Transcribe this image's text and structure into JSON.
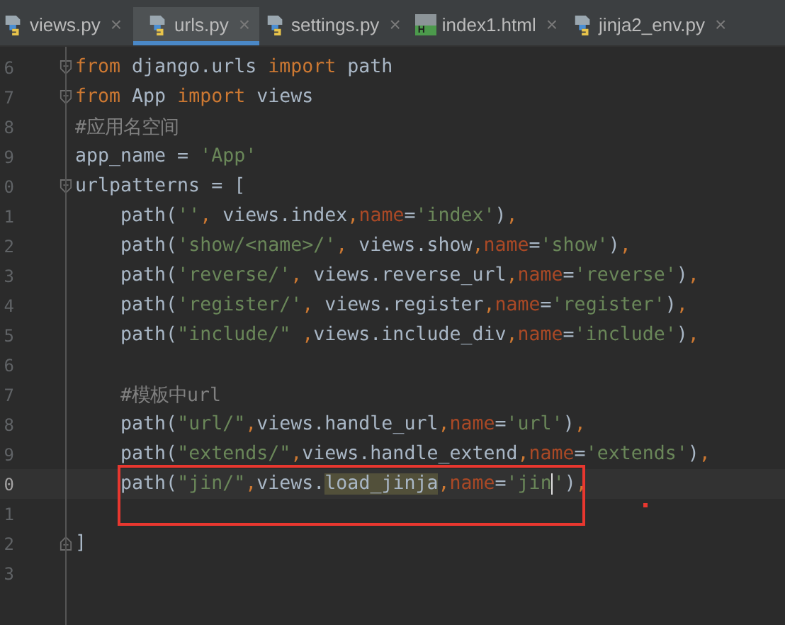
{
  "tabs": [
    {
      "label": "views.py",
      "kind": "python",
      "selected": false
    },
    {
      "label": "urls.py",
      "kind": "python",
      "selected": true
    },
    {
      "label": "settings.py",
      "kind": "python",
      "selected": false
    },
    {
      "label": "index1.html",
      "kind": "html",
      "badge": "H",
      "selected": false
    },
    {
      "label": "jinja2_env.py",
      "kind": "python",
      "selected": false
    }
  ],
  "close_glyph": "×",
  "lines": [
    {
      "number": "6",
      "fold_start": true,
      "current": false,
      "tokens": [
        {
          "kind": "keyword",
          "text": "from"
        },
        {
          "kind": "plain",
          "text": " django.urls "
        },
        {
          "kind": "keyword",
          "text": "import"
        },
        {
          "kind": "plain",
          "text": " path"
        }
      ]
    },
    {
      "number": "7",
      "fold_start": true,
      "current": false,
      "tokens": [
        {
          "kind": "keyword",
          "text": "from"
        },
        {
          "kind": "plain",
          "text": " App "
        },
        {
          "kind": "keyword",
          "text": "import"
        },
        {
          "kind": "plain",
          "text": " views"
        }
      ]
    },
    {
      "number": "8",
      "current": false,
      "tokens": [
        {
          "kind": "comment",
          "text": "#应用名空间"
        }
      ]
    },
    {
      "number": "9",
      "current": false,
      "tokens": [
        {
          "kind": "plain",
          "text": "app_name = "
        },
        {
          "kind": "string",
          "text": "'App'"
        }
      ]
    },
    {
      "number": "0",
      "fold_start": true,
      "current": false,
      "tokens": [
        {
          "kind": "plain",
          "text": "urlpatterns = ["
        }
      ]
    },
    {
      "number": "1",
      "current": false,
      "tokens": [
        {
          "kind": "plain",
          "text": "    path("
        },
        {
          "kind": "string",
          "text": "''"
        },
        {
          "kind": "keyword",
          "text": ","
        },
        {
          "kind": "plain",
          "text": " views.index"
        },
        {
          "kind": "keyword",
          "text": ","
        },
        {
          "kind": "param",
          "text": "name"
        },
        {
          "kind": "plain",
          "text": "="
        },
        {
          "kind": "string",
          "text": "'index'"
        },
        {
          "kind": "plain",
          "text": ")"
        },
        {
          "kind": "keyword",
          "text": ","
        }
      ]
    },
    {
      "number": "2",
      "current": false,
      "tokens": [
        {
          "kind": "plain",
          "text": "    path("
        },
        {
          "kind": "string",
          "text": "'show/<name>/'"
        },
        {
          "kind": "keyword",
          "text": ","
        },
        {
          "kind": "plain",
          "text": " views.show"
        },
        {
          "kind": "keyword",
          "text": ","
        },
        {
          "kind": "param",
          "text": "name"
        },
        {
          "kind": "plain",
          "text": "="
        },
        {
          "kind": "string",
          "text": "'show'"
        },
        {
          "kind": "plain",
          "text": ")"
        },
        {
          "kind": "keyword",
          "text": ","
        }
      ]
    },
    {
      "number": "3",
      "current": false,
      "tokens": [
        {
          "kind": "plain",
          "text": "    path("
        },
        {
          "kind": "string",
          "text": "'reverse/'"
        },
        {
          "kind": "keyword",
          "text": ","
        },
        {
          "kind": "plain",
          "text": " views.reverse_url"
        },
        {
          "kind": "keyword",
          "text": ","
        },
        {
          "kind": "param",
          "text": "name"
        },
        {
          "kind": "plain",
          "text": "="
        },
        {
          "kind": "string",
          "text": "'reverse'"
        },
        {
          "kind": "plain",
          "text": ")"
        },
        {
          "kind": "keyword",
          "text": ","
        }
      ]
    },
    {
      "number": "4",
      "current": false,
      "tokens": [
        {
          "kind": "plain",
          "text": "    path("
        },
        {
          "kind": "string",
          "text": "'register/'"
        },
        {
          "kind": "keyword",
          "text": ","
        },
        {
          "kind": "plain",
          "text": " views.register"
        },
        {
          "kind": "keyword",
          "text": ","
        },
        {
          "kind": "param",
          "text": "name"
        },
        {
          "kind": "plain",
          "text": "="
        },
        {
          "kind": "string",
          "text": "'register'"
        },
        {
          "kind": "plain",
          "text": ")"
        },
        {
          "kind": "keyword",
          "text": ","
        }
      ]
    },
    {
      "number": "5",
      "current": false,
      "tokens": [
        {
          "kind": "plain",
          "text": "    path("
        },
        {
          "kind": "string",
          "text": "\"include/\" "
        },
        {
          "kind": "keyword",
          "text": ","
        },
        {
          "kind": "plain",
          "text": "views.include_div"
        },
        {
          "kind": "keyword",
          "text": ","
        },
        {
          "kind": "param",
          "text": "name"
        },
        {
          "kind": "plain",
          "text": "="
        },
        {
          "kind": "string",
          "text": "'include'"
        },
        {
          "kind": "plain",
          "text": ")"
        },
        {
          "kind": "keyword",
          "text": ","
        }
      ]
    },
    {
      "number": "6",
      "current": false
    },
    {
      "number": "7",
      "current": false,
      "tokens": [
        {
          "kind": "comment",
          "text": "    #模板中url"
        }
      ]
    },
    {
      "number": "8",
      "current": false,
      "tokens": [
        {
          "kind": "plain",
          "text": "    path("
        },
        {
          "kind": "string",
          "text": "\"url/\""
        },
        {
          "kind": "keyword",
          "text": ","
        },
        {
          "kind": "plain",
          "text": "views.handle_url"
        },
        {
          "kind": "keyword",
          "text": ","
        },
        {
          "kind": "param",
          "text": "name"
        },
        {
          "kind": "plain",
          "text": "="
        },
        {
          "kind": "string",
          "text": "'url'"
        },
        {
          "kind": "plain",
          "text": ")"
        },
        {
          "kind": "keyword",
          "text": ","
        }
      ]
    },
    {
      "number": "9",
      "current": false,
      "tokens": [
        {
          "kind": "plain",
          "text": "    path("
        },
        {
          "kind": "string",
          "text": "\"extends/\""
        },
        {
          "kind": "keyword",
          "text": ","
        },
        {
          "kind": "plain",
          "text": "views.handle_extend"
        },
        {
          "kind": "keyword",
          "text": ","
        },
        {
          "kind": "param",
          "text": "name"
        },
        {
          "kind": "plain",
          "text": "="
        },
        {
          "kind": "string",
          "text": "'extends'"
        },
        {
          "kind": "plain",
          "text": ")"
        },
        {
          "kind": "keyword",
          "text": ","
        }
      ]
    },
    {
      "number": "0",
      "current": true,
      "annotation_box": true,
      "annotation_dot": true,
      "tokens": [
        {
          "kind": "plain",
          "text": "    path("
        },
        {
          "kind": "string",
          "text": "\"jin/\""
        },
        {
          "kind": "keyword",
          "text": ","
        },
        {
          "kind": "plain",
          "text": "views."
        },
        {
          "kind": "highlight",
          "text": "load_jinja"
        },
        {
          "kind": "keyword",
          "text": ","
        },
        {
          "kind": "param",
          "text": "name"
        },
        {
          "kind": "plain",
          "text": "="
        },
        {
          "kind": "string",
          "text": "'jin"
        },
        {
          "kind": "caret"
        },
        {
          "kind": "string",
          "text": "'"
        },
        {
          "kind": "plain",
          "text": ")"
        },
        {
          "kind": "keyword",
          "text": ","
        }
      ]
    },
    {
      "number": "1",
      "current": false
    },
    {
      "number": "2",
      "fold_end": true,
      "current": false,
      "tokens": [
        {
          "kind": "plain",
          "text": "]"
        }
      ]
    },
    {
      "number": "3",
      "current": false
    }
  ]
}
